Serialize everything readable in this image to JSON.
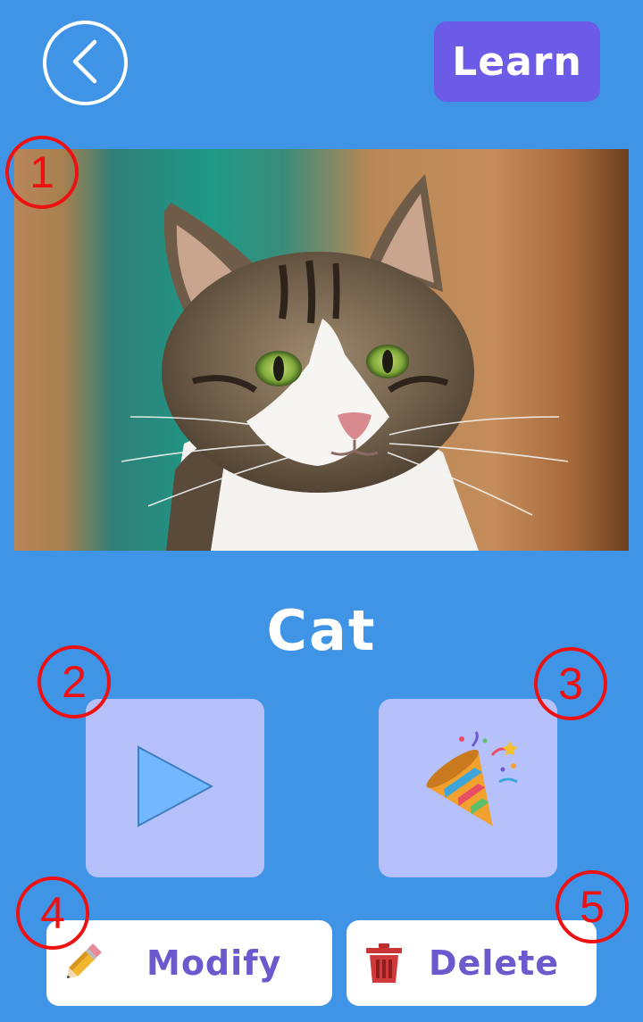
{
  "header": {
    "back_icon": "chevron-left-icon",
    "learn_label": "Learn",
    "learn_color": "#6C5BE6"
  },
  "main": {
    "image_subject": "cat",
    "word": "Cat"
  },
  "tiles": {
    "play_icon": "play-triangle-icon",
    "celebrate_icon": "party-popper-icon",
    "tile_color": "#B6C0FB"
  },
  "actions": {
    "modify_label": "Modify",
    "modify_icon": "pencil-icon",
    "delete_label": "Delete",
    "delete_icon": "trash-icon",
    "label_color": "#6A5ACD"
  },
  "markers": [
    "1",
    "2",
    "3",
    "4",
    "5"
  ],
  "colors": {
    "background": "#4094E6",
    "marker": "#EE1111"
  }
}
